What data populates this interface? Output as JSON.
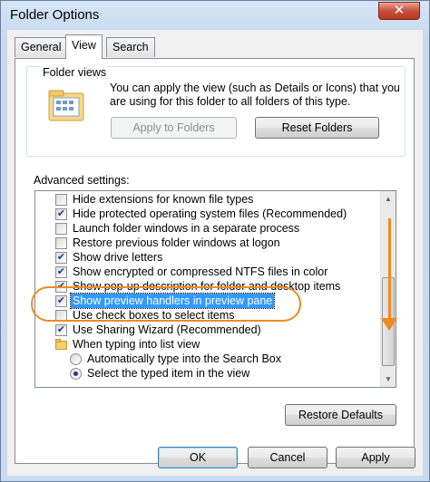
{
  "window": {
    "title": "Folder Options",
    "close_glyph": "✕"
  },
  "tabs": [
    {
      "label": "General",
      "active": false
    },
    {
      "label": "View",
      "active": true
    },
    {
      "label": "Search",
      "active": false
    }
  ],
  "folder_views": {
    "label": "Folder views",
    "description": "You can apply the view (such as Details or Icons) that you are using for this folder to all folders of this type.",
    "apply_button": "Apply to Folders",
    "reset_button": "Reset Folders"
  },
  "advanced": {
    "label": "Advanced settings:",
    "items": [
      {
        "type": "checkbox",
        "checked": false,
        "label": "Hide extensions for known file types"
      },
      {
        "type": "checkbox",
        "checked": true,
        "label": "Hide protected operating system files (Recommended)"
      },
      {
        "type": "checkbox",
        "checked": false,
        "label": "Launch folder windows in a separate process"
      },
      {
        "type": "checkbox",
        "checked": false,
        "label": "Restore previous folder windows at logon"
      },
      {
        "type": "checkbox",
        "checked": true,
        "label": "Show drive letters"
      },
      {
        "type": "checkbox",
        "checked": true,
        "label": "Show encrypted or compressed NTFS files in color"
      },
      {
        "type": "checkbox",
        "checked": true,
        "label": "Show pop-up description for folder and desktop items"
      },
      {
        "type": "checkbox",
        "checked": true,
        "selected": true,
        "label": "Show preview handlers in preview pane"
      },
      {
        "type": "checkbox",
        "checked": false,
        "label": "Use check boxes to select items"
      },
      {
        "type": "checkbox",
        "checked": true,
        "label": "Use Sharing Wizard (Recommended)"
      },
      {
        "type": "folder",
        "label": "When typing into list view"
      },
      {
        "type": "radio",
        "checked": false,
        "label": "Automatically type into the Search Box"
      },
      {
        "type": "radio",
        "checked": true,
        "label": "Select the typed item in the view"
      }
    ],
    "restore_button": "Restore Defaults"
  },
  "footer": {
    "ok": "OK",
    "cancel": "Cancel",
    "apply": "Apply"
  },
  "colors": {
    "annotation": "#f08a24",
    "selection": "#3399ff"
  }
}
